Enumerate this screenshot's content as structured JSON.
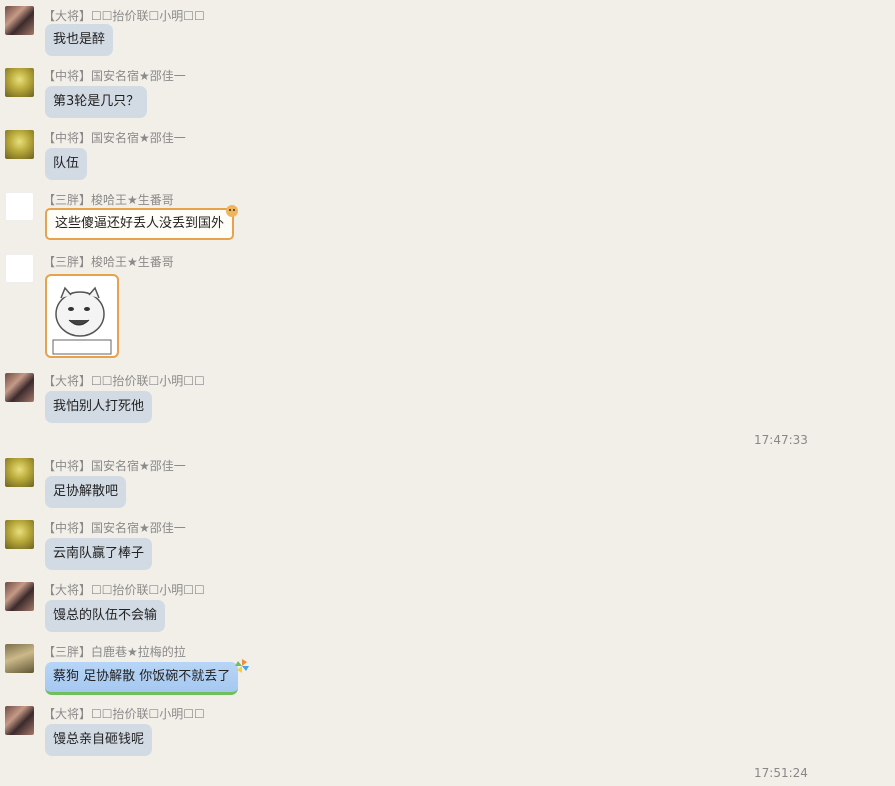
{
  "messages": [
    {
      "sender": "【大将】☐☐抬价联☐小明☐☐",
      "text": "我也是醉",
      "avatar": "dajiang"
    },
    {
      "sender": "【中将】国安名宿★邵佳一",
      "text": "第3轮是几只？",
      "avatar": "zhongjiang"
    },
    {
      "sender": "【中将】国安名宿★邵佳一",
      "text": "队伍",
      "avatar": "zhongjiang"
    },
    {
      "sender": "【三胖】梭哈王★生番哥",
      "text": "这些傻逼还好丢人没丢到国外",
      "avatar": "sanpang"
    },
    {
      "sender": "【三胖】梭哈王★生番哥",
      "text": "",
      "avatar": "sanpang",
      "sticker": "face-sticker"
    },
    {
      "sender": "【大将】☐☐抬价联☐小明☐☐",
      "text": "我怕别人打死他",
      "avatar": "dajiang"
    },
    {
      "sender": "【中将】国安名宿★邵佳一",
      "text": "足协解散吧",
      "avatar": "zhongjiang"
    },
    {
      "sender": "【中将】国安名宿★邵佳一",
      "text": "云南队赢了棒子",
      "avatar": "zhongjiang"
    },
    {
      "sender": "【大将】☐☐抬价联☐小明☐☐",
      "text": "馒总的队伍不会输",
      "avatar": "dajiang"
    },
    {
      "sender": "【三胖】白鹿巷★拉梅的拉",
      "text": "蔡狗 足协解散 你饭碗不就丢了",
      "avatar": "bailu"
    },
    {
      "sender": "【大将】☐☐抬价联☐小明☐☐",
      "text": "馒总亲自砸钱呢",
      "avatar": "dajiang"
    }
  ],
  "timestamps": [
    "17:47:33",
    "17:51:24"
  ]
}
